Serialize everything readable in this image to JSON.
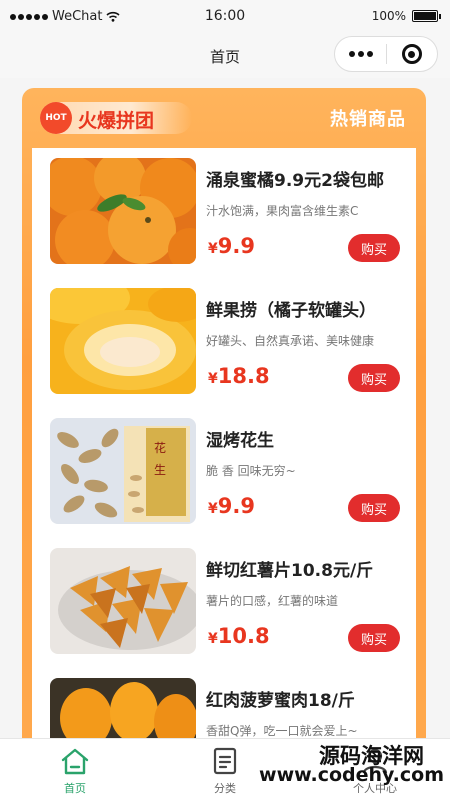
{
  "status_bar": {
    "carrier": "WeChat",
    "time": "16:00",
    "battery": "100%",
    "battery_level": 1.0
  },
  "nav": {
    "title": "首页"
  },
  "panel": {
    "hot_logo": "HOT",
    "badge_text": "火爆拼团",
    "right_title": "热销商品"
  },
  "products": [
    {
      "title": "涌泉蜜橘9.9元2袋包邮",
      "desc": "汁水饱满，果肉富含维生素C",
      "price_symbol": "¥",
      "price": "9.9",
      "buy_label": "购买",
      "image": "mandarin-oranges"
    },
    {
      "title": "鲜果捞（橘子软罐头）",
      "desc": "好罐头、自然真承诺、美味健康",
      "price_symbol": "¥",
      "price": "18.8",
      "buy_label": "购买",
      "image": "peach-cup"
    },
    {
      "title": "湿烤花生",
      "desc": "脆 香 回味无穷~",
      "price_symbol": "¥",
      "price": "9.9",
      "buy_label": "购买",
      "image": "roasted-peanuts"
    },
    {
      "title": "鲜切红薯片10.8元/斤",
      "desc": "薯片的口感，红薯的味道",
      "price_symbol": "¥",
      "price": "10.8",
      "buy_label": "购买",
      "image": "sweet-potato-chips"
    },
    {
      "title": "红肉菠萝蜜肉18/斤",
      "desc": "香甜Q弹，吃一口就会爱上~",
      "price_symbol": "¥",
      "price": "",
      "buy_label": "",
      "image": "jackfruit"
    }
  ],
  "tabs": [
    {
      "label": "首页",
      "icon": "home-icon",
      "active": true
    },
    {
      "label": "分类",
      "icon": "category-icon",
      "active": false
    },
    {
      "label": "个人中心",
      "icon": "user-icon",
      "active": false
    }
  ],
  "watermark": {
    "cn": "源码海洋网",
    "url": "www.codehy.com"
  },
  "colors": {
    "accent": "#e22d2d",
    "price": "#e8361f",
    "panel": "#ffa94d",
    "tab_active": "#2aa36b"
  }
}
